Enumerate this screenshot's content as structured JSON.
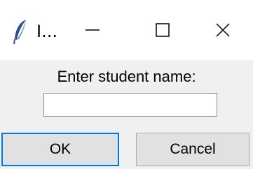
{
  "window": {
    "title": "I...",
    "icon": "tk-feather-icon"
  },
  "titlebar": {
    "minimize_icon": "minimize-icon",
    "maximize_icon": "maximize-icon",
    "close_icon": "close-icon"
  },
  "dialog": {
    "prompt": "Enter student name:",
    "input_value": "",
    "ok_label": "OK",
    "cancel_label": "Cancel"
  },
  "colors": {
    "content_bg": "#f0f0f0",
    "button_bg": "#e1e1e1",
    "focus_border": "#0078d7"
  }
}
